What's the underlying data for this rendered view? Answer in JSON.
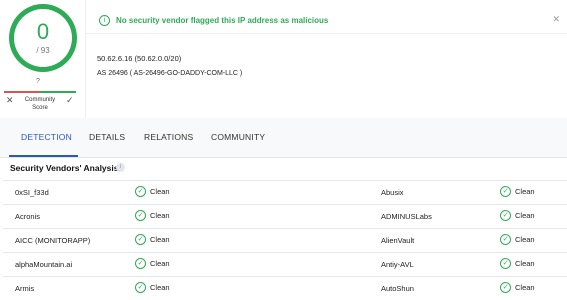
{
  "score": {
    "detected": "0",
    "total": "/ 93",
    "color": "#2eab57"
  },
  "community": {
    "score": "?",
    "label": "Community Score",
    "negative_icon": "close-icon",
    "positive_icon": "check-icon"
  },
  "alert": {
    "text": "No security vendor flagged this IP address as malicious",
    "icon": "info-icon",
    "color": "#2eab57"
  },
  "ip": {
    "address_line": "50.62.6.16  (50.62.0.0/20)",
    "as_line": "AS 26496  ( AS-26496-GO-DADDY-COM-LLC )"
  },
  "tabs": [
    {
      "label": "DETECTION",
      "active": true
    },
    {
      "label": "DETAILS",
      "active": false
    },
    {
      "label": "RELATIONS",
      "active": false
    },
    {
      "label": "COMMUNITY",
      "active": false
    }
  ],
  "section": {
    "title": "Security Vendors' Analysis",
    "info_icon": "info-icon"
  },
  "vendors": [
    {
      "left_name": "0xSI_f33d",
      "left_result": "Clean",
      "right_name": "Abusix",
      "right_result": "Clean"
    },
    {
      "left_name": "Acronis",
      "left_result": "Clean",
      "right_name": "ADMINUSLabs",
      "right_result": "Clean"
    },
    {
      "left_name": "AICC (MONITORAPP)",
      "left_result": "Clean",
      "right_name": "AlienVault",
      "right_result": "Clean"
    },
    {
      "left_name": "alphaMountain.ai",
      "left_result": "Clean",
      "right_name": "Antiy-AVL",
      "right_result": "Clean"
    },
    {
      "left_name": "Armis",
      "left_result": "Clean",
      "right_name": "AutoShun",
      "right_result": "Clean"
    }
  ],
  "colors": {
    "accent": "#2a56c6",
    "clean": "#2eab57",
    "malicious": "#d9534f"
  }
}
